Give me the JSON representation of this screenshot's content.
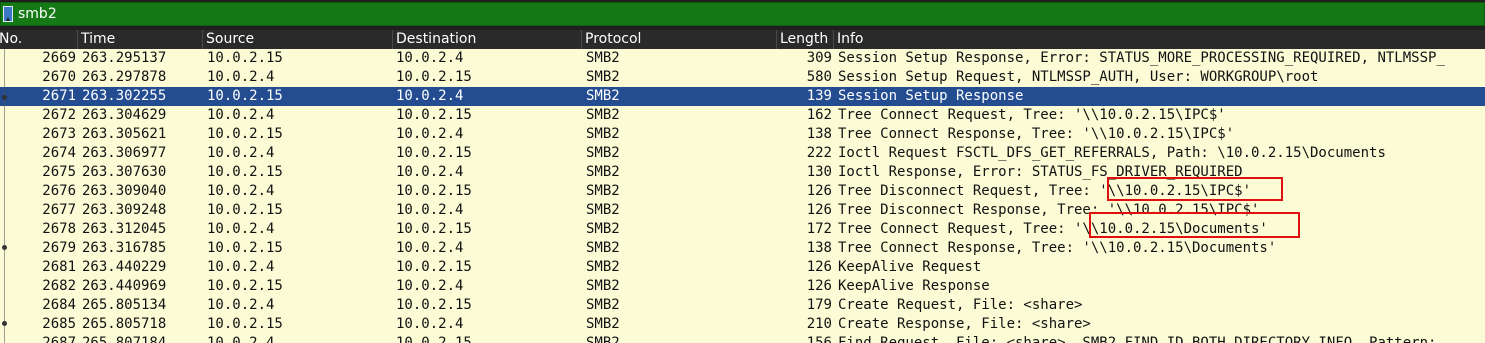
{
  "filter": {
    "value": "smb2",
    "icon": "bookmark-icon"
  },
  "columns": [
    "No.",
    "Time",
    "Source",
    "Destination",
    "Protocol",
    "Length",
    "Info"
  ],
  "colors": {
    "row_bg": "#fbfbd6",
    "selected_bg": "#244d91",
    "filter_bg": "#157a15",
    "highlight": "#e01010"
  },
  "packets": [
    {
      "no": "2669",
      "time": "263.295137",
      "src": "10.0.2.15",
      "dst": "10.0.2.4",
      "proto": "SMB2",
      "len": "309",
      "info": "Session Setup Response, Error: STATUS_MORE_PROCESSING_REQUIRED, NTLMSSP_"
    },
    {
      "no": "2670",
      "time": "263.297878",
      "src": "10.0.2.4",
      "dst": "10.0.2.15",
      "proto": "SMB2",
      "len": "580",
      "info": "Session Setup Request, NTLMSSP_AUTH, User: WORKGROUP\\root"
    },
    {
      "no": "2671",
      "time": "263.302255",
      "src": "10.0.2.15",
      "dst": "10.0.2.4",
      "proto": "SMB2",
      "len": "139",
      "info": "Session Setup Response",
      "selected": true
    },
    {
      "no": "2672",
      "time": "263.304629",
      "src": "10.0.2.4",
      "dst": "10.0.2.15",
      "proto": "SMB2",
      "len": "162",
      "info": "Tree Connect Request, Tree: '\\\\10.0.2.15\\IPC$'"
    },
    {
      "no": "2673",
      "time": "263.305621",
      "src": "10.0.2.15",
      "dst": "10.0.2.4",
      "proto": "SMB2",
      "len": "138",
      "info": "Tree Connect Response, Tree: '\\\\10.0.2.15\\IPC$'"
    },
    {
      "no": "2674",
      "time": "263.306977",
      "src": "10.0.2.4",
      "dst": "10.0.2.15",
      "proto": "SMB2",
      "len": "222",
      "info": "Ioctl Request FSCTL_DFS_GET_REFERRALS, Path: \\10.0.2.15\\Documents"
    },
    {
      "no": "2675",
      "time": "263.307630",
      "src": "10.0.2.15",
      "dst": "10.0.2.4",
      "proto": "SMB2",
      "len": "130",
      "info": "Ioctl Response, Error: STATUS_FS_DRIVER_REQUIRED"
    },
    {
      "no": "2676",
      "time": "263.309040",
      "src": "10.0.2.4",
      "dst": "10.0.2.15",
      "proto": "SMB2",
      "len": "126",
      "info": "Tree Disconnect Request, Tree: '\\\\10.0.2.15\\IPC$'"
    },
    {
      "no": "2677",
      "time": "263.309248",
      "src": "10.0.2.15",
      "dst": "10.0.2.4",
      "proto": "SMB2",
      "len": "126",
      "info": "Tree Disconnect Response, Tree: '\\\\10.0.2.15\\IPC$'"
    },
    {
      "no": "2678",
      "time": "263.312045",
      "src": "10.0.2.4",
      "dst": "10.0.2.15",
      "proto": "SMB2",
      "len": "172",
      "info": "Tree Connect Request, Tree: '\\\\10.0.2.15\\Documents'"
    },
    {
      "no": "2679",
      "time": "263.316785",
      "src": "10.0.2.15",
      "dst": "10.0.2.4",
      "proto": "SMB2",
      "len": "138",
      "info": "Tree Connect Response, Tree: '\\\\10.0.2.15\\Documents'"
    },
    {
      "no": "2681",
      "time": "263.440229",
      "src": "10.0.2.4",
      "dst": "10.0.2.15",
      "proto": "SMB2",
      "len": "126",
      "info": "KeepAlive Request"
    },
    {
      "no": "2682",
      "time": "263.440969",
      "src": "10.0.2.15",
      "dst": "10.0.2.4",
      "proto": "SMB2",
      "len": "126",
      "info": "KeepAlive Response"
    },
    {
      "no": "2684",
      "time": "265.805134",
      "src": "10.0.2.4",
      "dst": "10.0.2.15",
      "proto": "SMB2",
      "len": "179",
      "info": "Create Request, File: <share>"
    },
    {
      "no": "2685",
      "time": "265.805718",
      "src": "10.0.2.15",
      "dst": "10.0.2.4",
      "proto": "SMB2",
      "len": "210",
      "info": "Create Response, File: <share>"
    },
    {
      "no": "2687",
      "time": "265.807184",
      "src": "10.0.2.4",
      "dst": "10.0.2.15",
      "proto": "SMB2",
      "len": "156",
      "info": "Find Request, File: <share>, SMB2_FIND_ID_BOTH_DIRECTORY_INFO, Pattern:"
    }
  ]
}
